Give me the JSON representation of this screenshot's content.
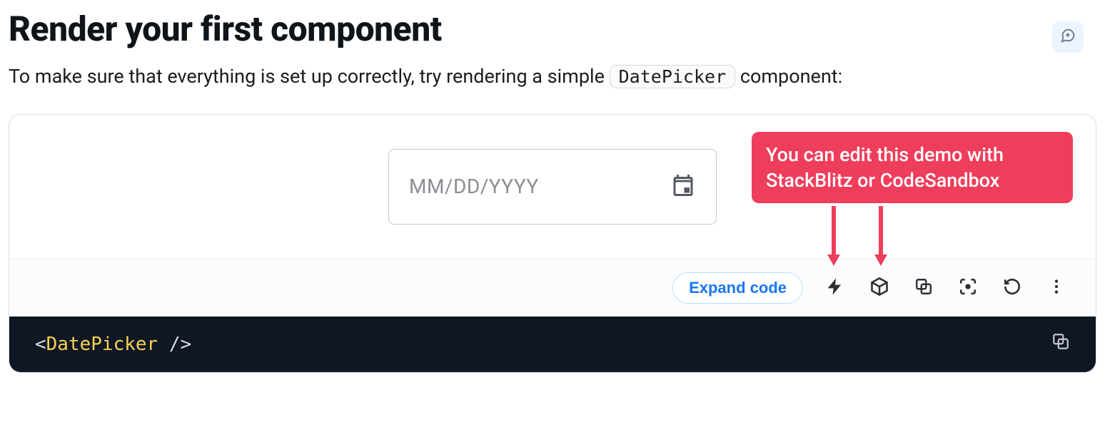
{
  "heading": "Render your first component",
  "intro": {
    "text_before": "To make sure that everything is set up correctly, try rendering a simple ",
    "code": "DatePicker",
    "text_after": " component:"
  },
  "demo": {
    "placeholder": "MM/DD/YYYY",
    "tooltip": "You can edit this demo with StackBlitz or CodeSandbox"
  },
  "toolbar": {
    "expand_label": "Expand code"
  },
  "code": {
    "open": "<",
    "tag": "DatePicker",
    "close": " />"
  }
}
